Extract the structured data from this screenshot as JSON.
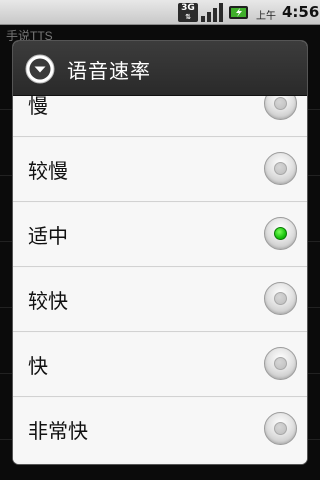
{
  "status_bar": {
    "network_type": "3G",
    "time_prefix": "上午",
    "time": "4:56"
  },
  "background_app": {
    "title": "手说TTS"
  },
  "dialog": {
    "title": "语音速率",
    "options": [
      {
        "label": "慢",
        "checked": false
      },
      {
        "label": "较慢",
        "checked": false
      },
      {
        "label": "适中",
        "checked": true
      },
      {
        "label": "较快",
        "checked": false
      },
      {
        "label": "快",
        "checked": false
      },
      {
        "label": "非常快",
        "checked": false
      }
    ]
  },
  "colors": {
    "checked_radio": "#19c40e",
    "dialog_header": "#333333",
    "dialog_body": "#f5f5f5"
  }
}
